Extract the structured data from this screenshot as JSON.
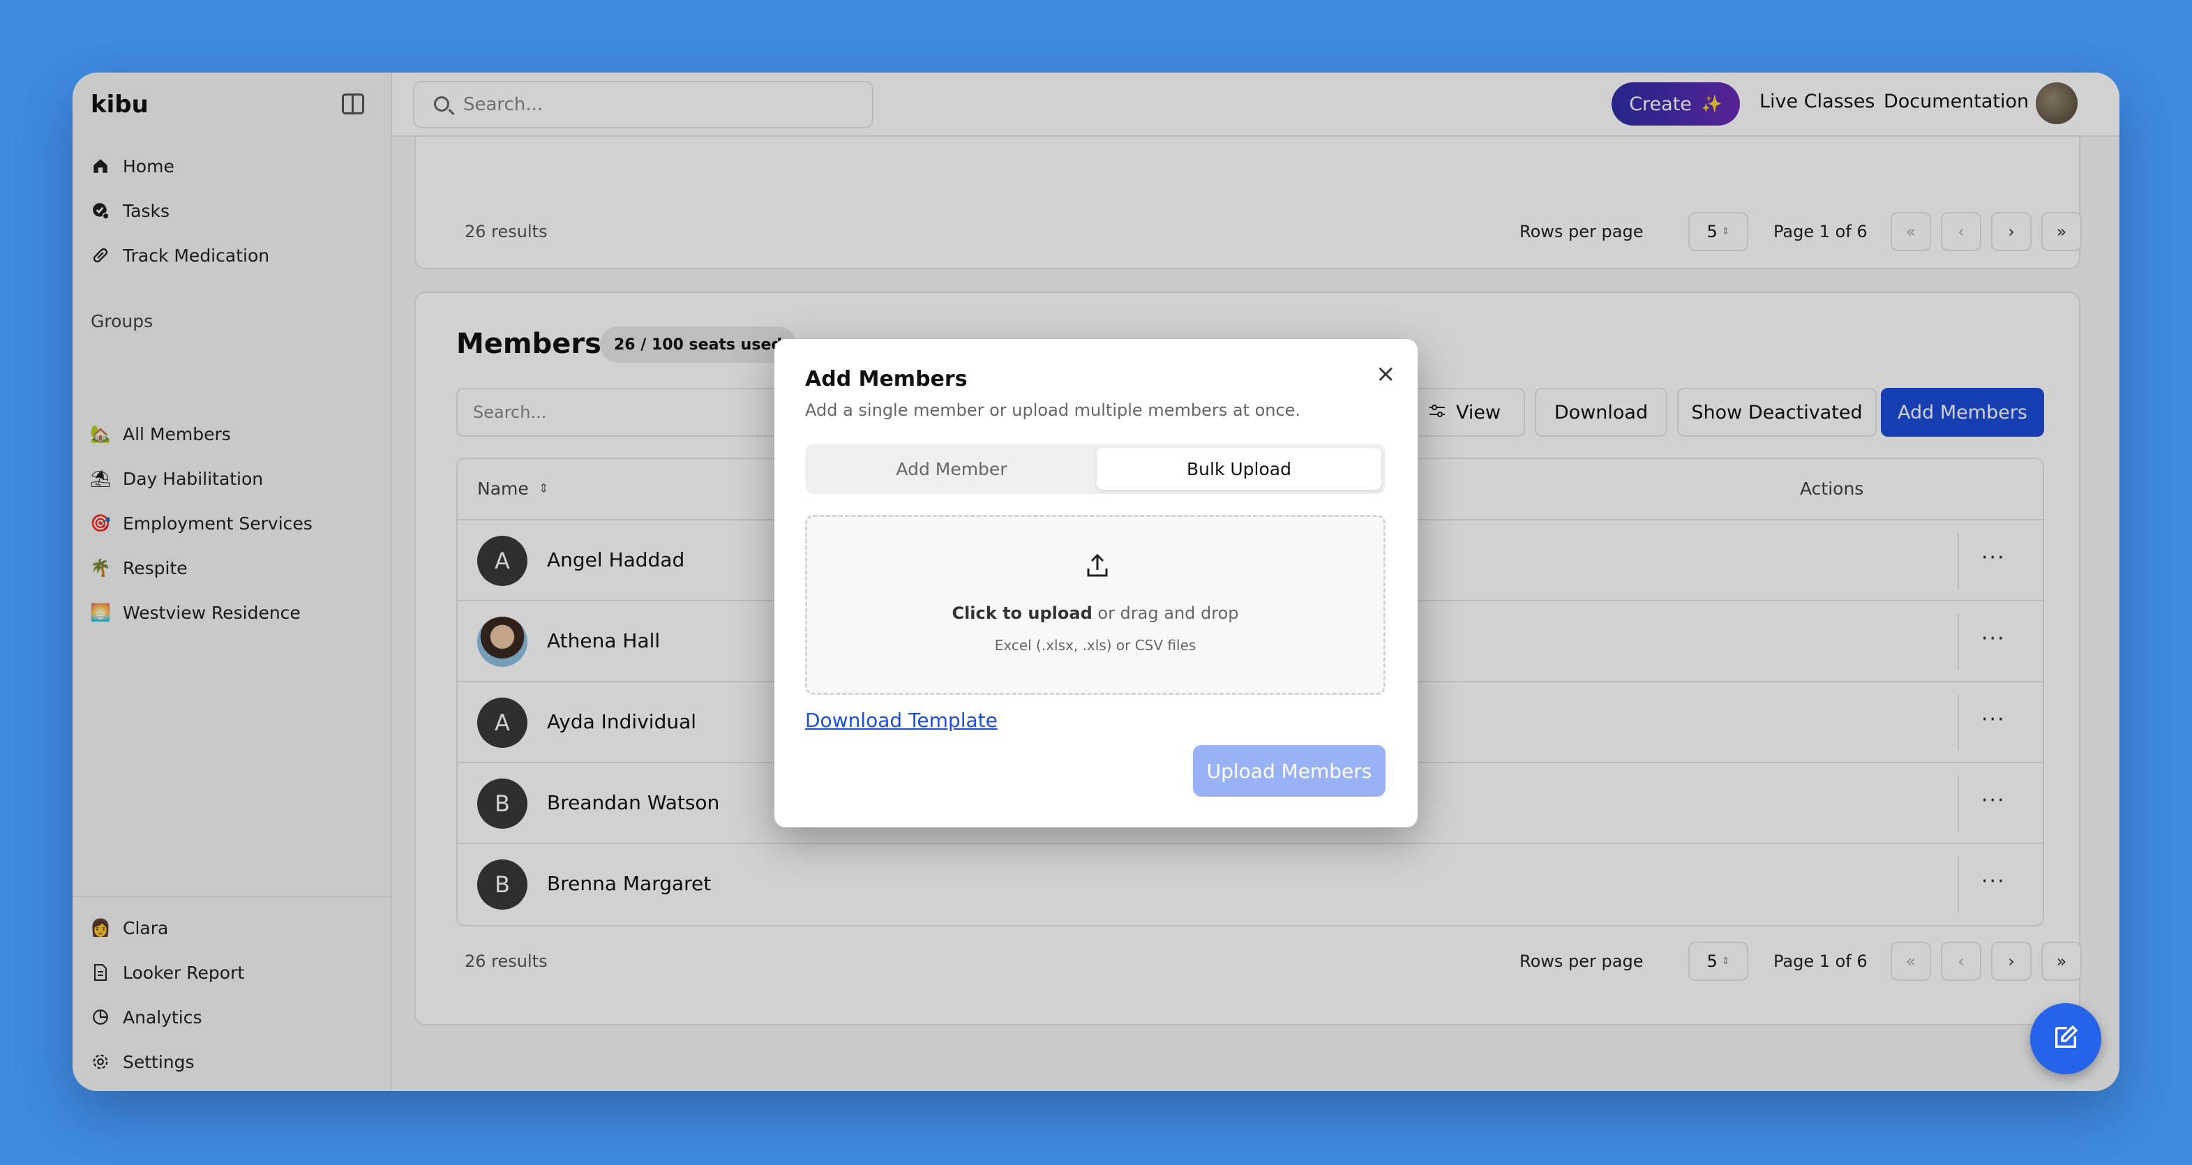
{
  "app": {
    "logo": "kibu"
  },
  "sidebar": {
    "nav": [
      {
        "label": "Home",
        "icon": "home-icon"
      },
      {
        "label": "Tasks",
        "icon": "tasks-icon"
      },
      {
        "label": "Track Medication",
        "icon": "pill-icon"
      }
    ],
    "groups_label": "Groups",
    "groups": [
      {
        "label": "All Members",
        "emoji": "🏡"
      },
      {
        "label": "Day Habilitation",
        "emoji": "⛱"
      },
      {
        "label": "Employment Services",
        "emoji": "🎯"
      },
      {
        "label": "Respite",
        "emoji": "🌴"
      },
      {
        "label": "Westview Residence",
        "emoji": "🌅"
      }
    ],
    "bottom": [
      {
        "label": "Clara",
        "emoji": "👩"
      },
      {
        "label": "Looker Report",
        "icon": "document-icon"
      },
      {
        "label": "Analytics",
        "icon": "pie-chart-icon"
      },
      {
        "label": "Settings",
        "icon": "gear-icon"
      }
    ]
  },
  "topbar": {
    "search_placeholder": "Search...",
    "create_label": "Create",
    "live_classes": "Live Classes",
    "documentation": "Documentation"
  },
  "top_card": {
    "results": "26 results",
    "rows_per_page_label": "Rows per page",
    "rows_per_page_value": "5",
    "page_label": "Page 1 of 6"
  },
  "members": {
    "title": "Members",
    "seats_badge": "26 / 100 seats used",
    "search_placeholder": "Search...",
    "view_label": "View",
    "download_label": "Download",
    "show_deactivated_label": "Show Deactivated",
    "add_members_label": "Add Members",
    "columns": {
      "name": "Name",
      "actions": "Actions"
    },
    "rows": [
      {
        "initial": "A",
        "name": "Angel Haddad",
        "photo": false
      },
      {
        "initial": "",
        "name": "Athena Hall",
        "photo": true
      },
      {
        "initial": "A",
        "name": "Ayda Individual",
        "photo": false
      },
      {
        "initial": "B",
        "name": "Breandan Watson",
        "photo": false
      },
      {
        "initial": "B",
        "name": "Brenna Margaret",
        "photo": false
      }
    ],
    "results": "26 results",
    "rows_per_page_label": "Rows per page",
    "rows_per_page_value": "5",
    "page_label": "Page 1 of 6"
  },
  "modal": {
    "title": "Add Members",
    "subtitle": "Add a single member or upload multiple members at once.",
    "tab_single": "Add Member",
    "tab_bulk": "Bulk Upload",
    "dropzone_click": "Click to upload",
    "dropzone_rest": " or drag and drop",
    "dropzone_formats": "Excel (.xlsx, .xls) or CSV files",
    "download_template": "Download Template",
    "upload_button": "Upload Members"
  },
  "colors": {
    "primary": "#1d4ed8",
    "create_gradient_start": "#2d2fa8",
    "create_gradient_end": "#6a2bb5",
    "upload_disabled": "#98b2f5",
    "background": "#3f8ae2"
  }
}
